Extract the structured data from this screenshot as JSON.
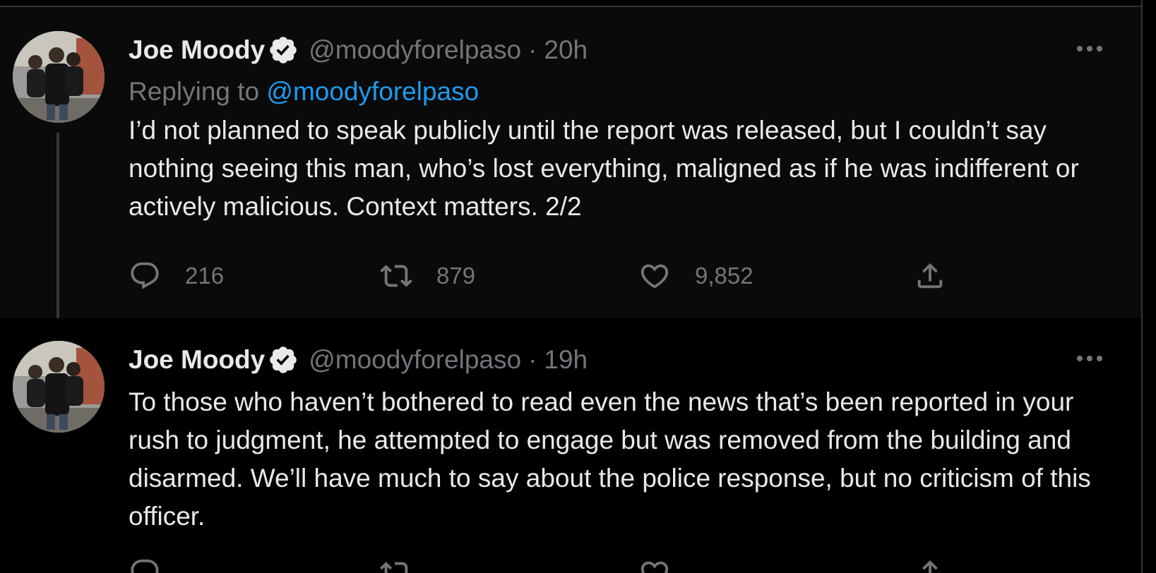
{
  "tweets": [
    {
      "author_name": "Joe Moody",
      "handle": "@moodyforelpaso",
      "separator": "·",
      "time": "20h",
      "replying_prefix": "Replying to",
      "replying_to": "@moodyforelpaso",
      "text": "I’d not planned to speak publicly until the report was released, but I couldn’t say nothing seeing this man, who’s lost everything, maligned as if he was indifferent or actively malicious. Context matters. 2/2",
      "replies": "216",
      "retweets": "879",
      "likes": "9,852"
    },
    {
      "author_name": "Joe Moody",
      "handle": "@moodyforelpaso",
      "separator": "·",
      "time": "19h",
      "text": "To those who haven’t bothered to read even the news that’s been reported in your rush to judgment, he attempted to engage but was removed from the building and disarmed. We’ll have much to say about the police response, but no criticism of this officer."
    }
  ],
  "icons": {
    "verified": "verified-badge-icon",
    "more": "more-options-icon",
    "reply": "reply-bubble-icon",
    "retweet": "retweet-icon",
    "like": "heart-icon",
    "share": "share-icon"
  },
  "colors": {
    "background": "#000000",
    "highlight_background": "#0a0a0a",
    "primary_text": "#e7e9ea",
    "secondary_text": "#71767b",
    "link": "#1d9bf0",
    "border": "#2f3336"
  }
}
